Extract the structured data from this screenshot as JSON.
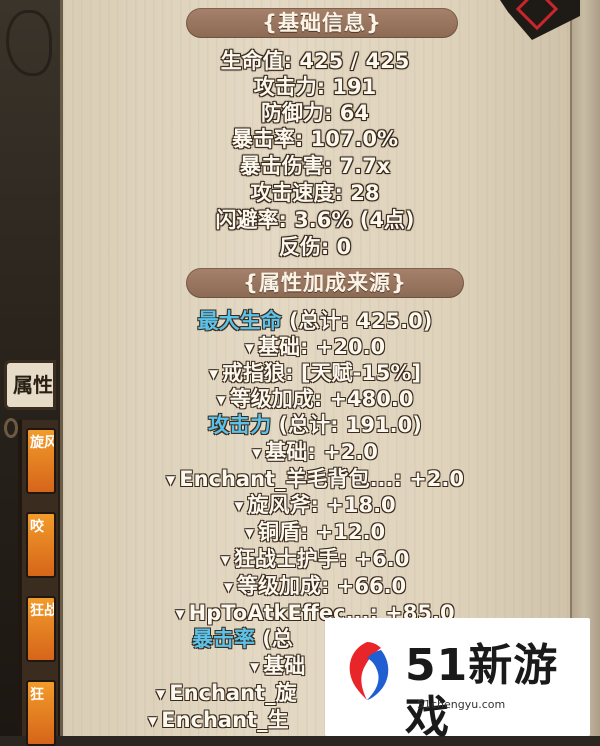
{
  "side_panel": {
    "tab_label": "属性",
    "cards": [
      "旋风",
      "咬",
      "狂战",
      "狂"
    ]
  },
  "basic_info": {
    "header": "{基础信息}",
    "rows": [
      "生命值: 425 / 425",
      "攻击力: 191",
      "防御力: 64",
      "暴击率: 107.0%",
      "暴击伤害: 7.7x",
      "攻击速度: 28",
      "闪避率: 3.6% (4点)",
      "反伤: 0"
    ]
  },
  "bonus_sources": {
    "header": "{属性加成来源}",
    "groups": [
      {
        "category": "最大生命",
        "total": " (总计: 425.0)",
        "items": [
          "基础: +20.0",
          "戒指狼: [天赋-15%]",
          "等级加成: +480.0"
        ]
      },
      {
        "category": "攻击力",
        "total": " (总计: 191.0)",
        "items": [
          "基础: +2.0",
          "Enchant_羊毛背包...: +2.0",
          "旋风斧: +18.0",
          "铜盾: +12.0",
          "狂战士护手: +6.0",
          "等级加成: +66.0",
          "HpToAtkEffec...: +85.0"
        ]
      },
      {
        "category": "暴击率",
        "total": " (总",
        "items": [
          "基础",
          "Enchant_旋",
          "Enchant_生"
        ]
      }
    ]
  },
  "watermark": {
    "title": "51新游戏",
    "url": "51chengyu.com"
  },
  "colors": {
    "category": "#5bc2ea",
    "header_bg": "#97745e",
    "panel_bg": "#e0d5bf"
  }
}
